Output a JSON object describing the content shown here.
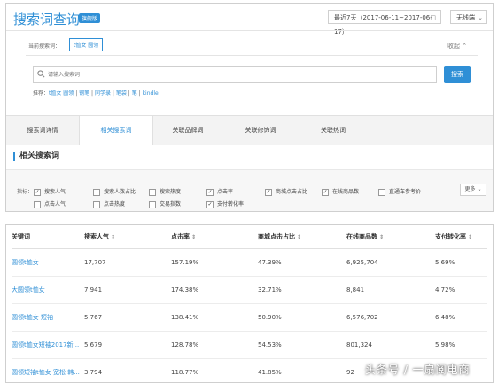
{
  "header": {
    "title": "搜索词查询",
    "badge": "旗舰版",
    "date_range": "最近7天（2017-06-11~2017-06-17）",
    "device": "无线端"
  },
  "current_keyword": {
    "label": "当前搜索词：",
    "value": "t恤女 圆领",
    "collapse_label": "收起"
  },
  "search": {
    "placeholder": "请输入搜索词",
    "button_label": "搜索"
  },
  "recommend": {
    "label": "推荐：",
    "items": [
      "t恤女 圆领",
      "钢笔",
      "同学录",
      "笔袋",
      "笔",
      "kindle"
    ]
  },
  "tabs": [
    "搜索词详情",
    "相关搜索词",
    "关联品牌词",
    "关联修饰词",
    "关联热词"
  ],
  "active_tab": 1,
  "section_title": "相关搜索词",
  "metrics": {
    "label": "指标：",
    "more_label": "更多",
    "options": [
      {
        "label": "搜索人气",
        "checked": true
      },
      {
        "label": "搜索人数占比",
        "checked": false
      },
      {
        "label": "搜索热度",
        "checked": false
      },
      {
        "label": "点击率",
        "checked": true
      },
      {
        "label": "商城点击占比",
        "checked": true
      },
      {
        "label": "在线商品数",
        "checked": true
      },
      {
        "label": "直通车参考价",
        "checked": false
      },
      {
        "label": "点击人气",
        "checked": false
      },
      {
        "label": "点击热度",
        "checked": false
      },
      {
        "label": "交易指数",
        "checked": false
      },
      {
        "label": "支付转化率",
        "checked": true
      }
    ]
  },
  "table": {
    "headers": [
      "关键词",
      "搜索人气",
      "点击率",
      "商城点击占比",
      "在线商品数",
      "支付转化率"
    ],
    "rows": [
      [
        "圆领t恤女",
        "17,707",
        "157.19%",
        "47.39%",
        "6,925,704",
        "5.69%"
      ],
      [
        "大圆领t恤女",
        "7,941",
        "174.38%",
        "32.71%",
        "8,841",
        "4.72%"
      ],
      [
        "圆领t恤女 短袖",
        "5,767",
        "138.41%",
        "50.90%",
        "6,576,702",
        "6.48%"
      ],
      [
        "圆领t恤女短袖2017新...",
        "5,679",
        "128.78%",
        "54.53%",
        "801,324",
        "5.98%"
      ],
      [
        "圆领短袖t恤女 宽松 韩...",
        "3,794",
        "118.77%",
        "41.85%",
        "92",
        ""
      ]
    ]
  },
  "watermark": "头条号 / 一扇阅电商"
}
